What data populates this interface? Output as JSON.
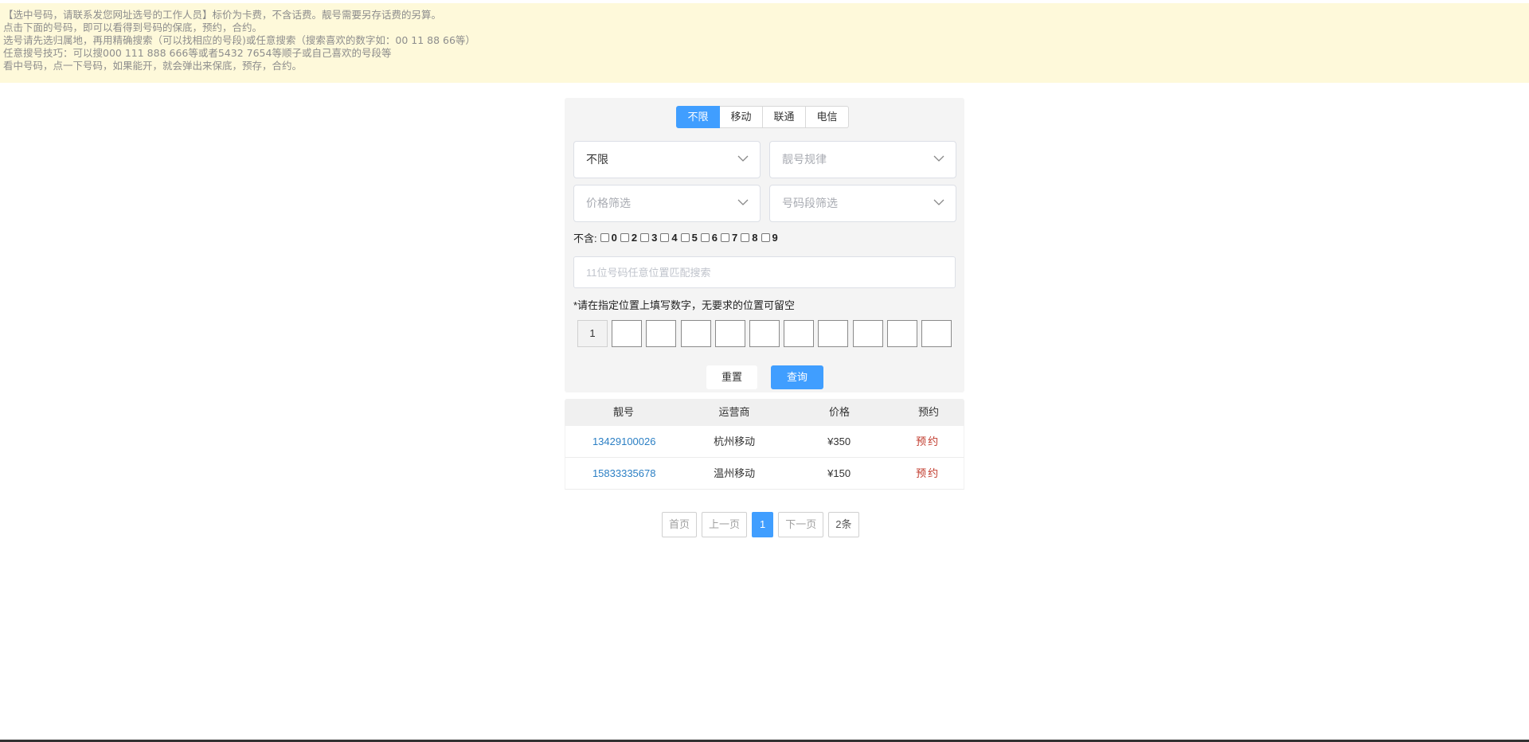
{
  "notice": {
    "lines": [
      "【选中号码，请联系发您网址选号的工作人员】标价为卡费，不含话费。靓号需要另存话费的另算。",
      "点击下面的号码，即可以看得到号码的保底，预约，合约。",
      " 选号请先选归属地，再用精确搜索（可以找相应的号段)或任意搜索（搜索喜欢的数字如：00  11  88  66等）",
      "任意搜号技巧：可以搜000  111  888  666等或者5432  7654等顺子或自己喜欢的号段等",
      "看中号码，点一下号码，如果能开，就会弹出来保底，预存，合约。"
    ]
  },
  "carrier_tabs": [
    "不限",
    "移动",
    "联通",
    "电信"
  ],
  "filters": {
    "region_value": "不限",
    "pattern_placeholder": "靓号规律",
    "price_placeholder": "价格筛选",
    "segment_placeholder": "号码段筛选"
  },
  "exclude": {
    "label": "不含:",
    "digits": [
      "0",
      "2",
      "3",
      "4",
      "5",
      "6",
      "7",
      "8",
      "9"
    ]
  },
  "search": {
    "placeholder": "11位号码任意位置匹配搜索"
  },
  "position_hint": "*请在指定位置上填写数字，无要求的位置可留空",
  "position_first_digit": "1",
  "buttons": {
    "reset": "重置",
    "query": "查询"
  },
  "table": {
    "headers": [
      "靓号",
      "运营商",
      "价格",
      "预约"
    ],
    "rows": [
      {
        "number": "13429100026",
        "carrier": "杭州移动",
        "price": "¥350",
        "action": "预约"
      },
      {
        "number": "15833335678",
        "carrier": "温州移动",
        "price": "¥150",
        "action": "预约"
      }
    ]
  },
  "pagination": {
    "first": "首页",
    "prev": "上一页",
    "current": "1",
    "next": "下一页",
    "total": "2条"
  },
  "colors": {
    "accent": "#409eff",
    "notice_bg": "#fef9da",
    "link": "#2b7fc4",
    "reserve": "#c0392b"
  }
}
